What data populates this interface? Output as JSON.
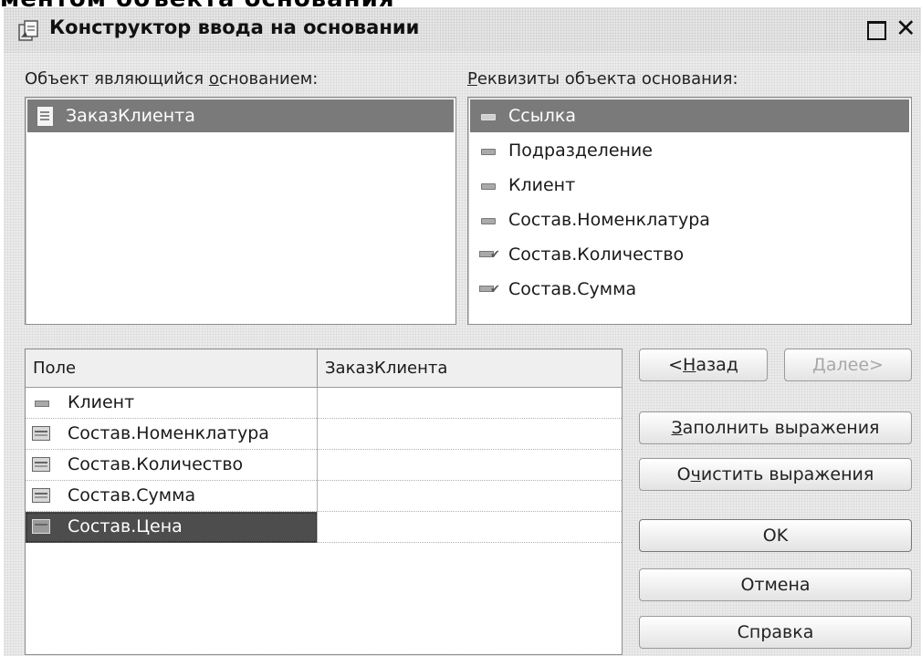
{
  "heading_fragment": "ментом объекта основания \"",
  "window": {
    "title": "Конструктор ввода на основании",
    "close_glyph": "✕"
  },
  "base_object": {
    "label_pre": "Объект являющийся ",
    "label_u": "о",
    "label_post": "снованием:",
    "items": [
      {
        "label": "ЗаказКлиента",
        "icon": "document-icon",
        "selected": true
      }
    ]
  },
  "attributes": {
    "label_u": "Р",
    "label_post": "еквизиты объекта основания:",
    "items": [
      {
        "label": "Ссылка",
        "icon": "attribute-icon",
        "selected": true
      },
      {
        "label": "Подразделение",
        "icon": "attribute-icon"
      },
      {
        "label": "Клиент",
        "icon": "attribute-icon"
      },
      {
        "label": "Состав.Номенклатура",
        "icon": "attribute-icon"
      },
      {
        "label": "Состав.Количество",
        "icon": "tabular-attribute-icon"
      },
      {
        "label": "Состав.Сумма",
        "icon": "tabular-attribute-icon"
      }
    ]
  },
  "mapping_table": {
    "columns": [
      "Поле",
      "ЗаказКлиента"
    ],
    "rows": [
      {
        "field": "Клиент",
        "value": "",
        "icon": "attribute-icon"
      },
      {
        "field": "Состав.Номенклатура",
        "value": "",
        "icon": "table-icon"
      },
      {
        "field": "Состав.Количество",
        "value": "",
        "icon": "table-icon"
      },
      {
        "field": "Состав.Сумма",
        "value": "",
        "icon": "table-icon"
      },
      {
        "field": "Состав.Цена",
        "value": "",
        "icon": "table-icon",
        "selected": true
      }
    ]
  },
  "buttons": {
    "back": {
      "pre": "<",
      "u": "Н",
      "post": "азад"
    },
    "next": {
      "u": "Д",
      "post": "алее>"
    },
    "fill": {
      "u": "З",
      "post": "аполнить выражения"
    },
    "clear": {
      "pre": "О",
      "u": "ч",
      "post": "истить выражения"
    },
    "ok": "OK",
    "cancel": "Отмена",
    "help": "Справка"
  }
}
